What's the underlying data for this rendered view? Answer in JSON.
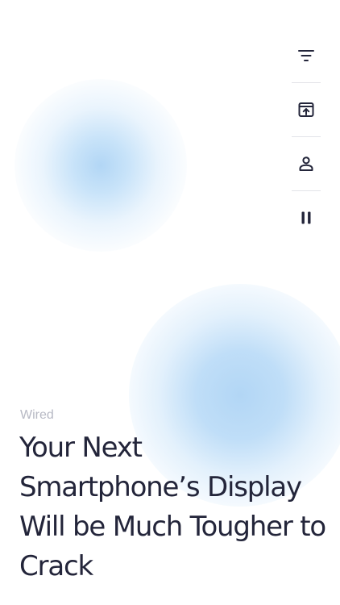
{
  "theme": {
    "background": "#ffffff",
    "blob_color": "#b2d6f5",
    "icon_color": "#23253a",
    "divider_color": "#e2e3e8",
    "source_color": "#b7b9c4",
    "headline_color": "#23253a"
  },
  "controls": [
    {
      "id": "filter",
      "icon": "filter-icon"
    },
    {
      "id": "share",
      "icon": "share-icon"
    },
    {
      "id": "profile",
      "icon": "person-icon"
    },
    {
      "id": "pause",
      "icon": "pause-icon"
    }
  ],
  "article": {
    "source": "Wired",
    "headline": "Your Next Smartphone’s Display Will be Much Tougher to Crack"
  }
}
